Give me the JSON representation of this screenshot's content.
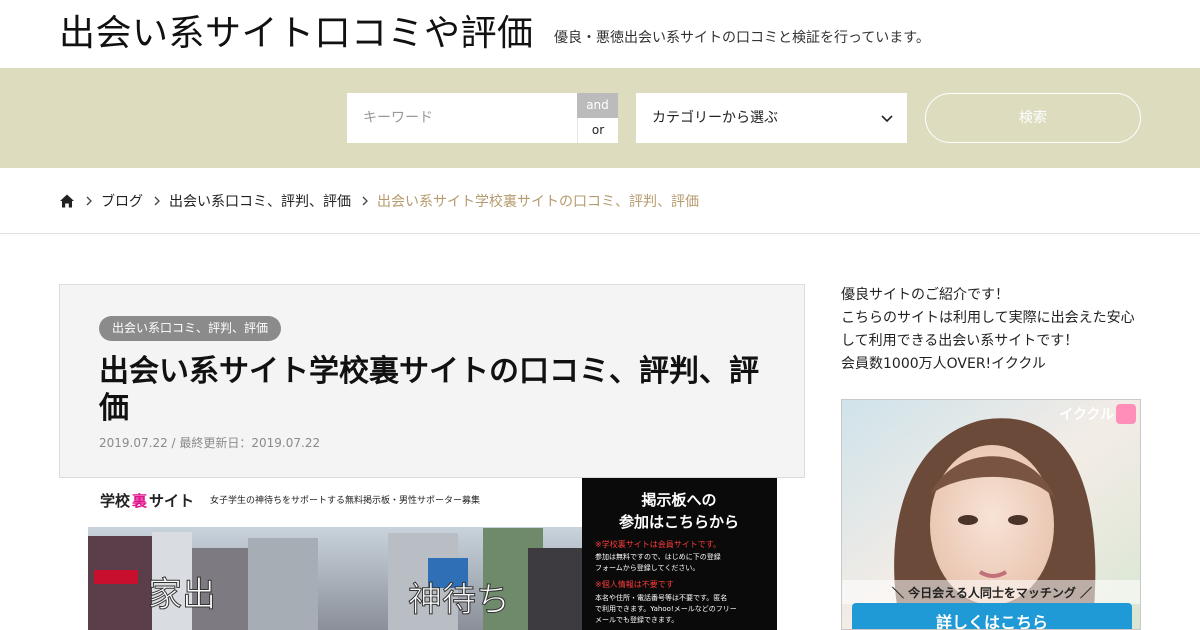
{
  "header": {
    "site_title": "出会い系サイト口コミや評価",
    "site_description": "優良・悪徳出会い系サイトの口コミと検証を行っています。"
  },
  "search": {
    "keyword_placeholder": "キーワード",
    "and_label": "and",
    "or_label": "or",
    "category_selected": "カテゴリーから選ぶ",
    "search_label": "検索",
    "band_color": "#dddcbf"
  },
  "breadcrumb": {
    "home_icon": "home-icon",
    "items": [
      "ブログ",
      "出会い系口コミ、評判、評価"
    ],
    "current": "出会い系サイト学校裏サイトの口コミ、評判、評価"
  },
  "article": {
    "category": "出会い系口コミ、評判、評価",
    "title": "出会い系サイト学校裏サイトの口コミ、評判、評価",
    "date": "2019.07.22 / 最終更新日：2019.07.22"
  },
  "eyecatch": {
    "logo_a": "学校",
    "logo_b": "裏",
    "logo_c": "サイト",
    "tagline": "女子学生の神待ちをサポートする無料掲示板・男性サポーター募集",
    "photo_word_1": "家出",
    "photo_word_2": "神待ち",
    "panel_title_1": "掲示板への",
    "panel_title_2": "参加はこちらから",
    "panel_note_1": "※学校裏サイトは会員サイトです。",
    "panel_line_1": "参加は無料ですので、はじめに下の登録",
    "panel_line_2": "フォームから登録してください。",
    "panel_note_2": "※個人情報は不要です",
    "panel_line_3": "本名や住所・電話番号等は不要です。匿名",
    "panel_line_4": "で利用できます。Yahoo!メールなどのフリー",
    "panel_line_5": "メールでも登録できます。"
  },
  "sidebar": {
    "intro": [
      "優良サイトのご紹介です！",
      "こちらのサイトは利用して実際に出会えた安心",
      "して利用できる出会い系サイトです！",
      "会員数1000万人OVER!イククル"
    ],
    "ad_brand": "イククル",
    "ad_catch": "＼ 今日会える人同士をマッチング ／",
    "ad_button": "詳しくはこちら"
  }
}
